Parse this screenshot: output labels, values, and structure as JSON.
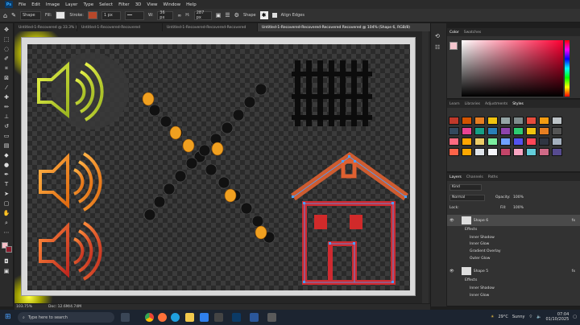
{
  "menu": {
    "items": [
      "File",
      "Edit",
      "Image",
      "Layer",
      "Type",
      "Select",
      "Filter",
      "3D",
      "View",
      "Window",
      "Help"
    ]
  },
  "options": {
    "mode": "Shape",
    "fill_label": "Fill:",
    "stroke_label": "Stroke:",
    "stroke_width": "1 px",
    "w_label": "W:",
    "w_value": "36 px",
    "h_label": "H:",
    "h_value": "287 px",
    "path_label": "Shape",
    "align_label": "Align Edges"
  },
  "tabs": [
    "Untitled-1-Recovered @ 33.3% (...",
    "Untitled-1-Recovered-Recovered",
    "Untitled-1-Recovered-Recovered-Recovered",
    "Untitled-1-Recovered-Recovered-Recovered Recovered @ 104% (Shape 6, RGB/8)"
  ],
  "status": {
    "zoom": "103.75%",
    "doc": "Doc: 12.6M/4.74M"
  },
  "panels": {
    "color_tabs": [
      "Color",
      "Swatches"
    ],
    "style_tabs": [
      "Learn",
      "Libraries",
      "Adjustments",
      "Styles"
    ],
    "layer_tabs": [
      "Layers",
      "Channels",
      "Paths"
    ],
    "kind": "Kind",
    "blend": "Normal",
    "opacity_label": "Opacity:",
    "opacity": "100%",
    "lock_label": "Lock:",
    "fill_label": "Fill:",
    "fill": "100%",
    "layers": [
      {
        "name": "Shape 6",
        "kind": "layer"
      },
      {
        "name": "Effects",
        "kind": "fxgroup"
      },
      {
        "name": "Inner Shadow",
        "kind": "effect"
      },
      {
        "name": "Inner Glow",
        "kind": "effect"
      },
      {
        "name": "Gradient Overlay",
        "kind": "effect"
      },
      {
        "name": "Outer Glow",
        "kind": "effect"
      },
      {
        "name": "Shape 5",
        "kind": "layer"
      },
      {
        "name": "Effects",
        "kind": "fxgroup"
      },
      {
        "name": "Inner Shadow",
        "kind": "effect"
      },
      {
        "name": "Inner Glow",
        "kind": "effect"
      }
    ],
    "fx_label": "fx"
  },
  "swatch_colors": [
    "#c0392b",
    "#d35400",
    "#e67e22",
    "#f1c40f",
    "#95a5a6",
    "#7f8c8d",
    "#e74c3c",
    "#f39c12",
    "#bdc3c7",
    "#34495e",
    "#e84393",
    "#16a085",
    "#2980b9",
    "#8e44ad",
    "#2ecc71",
    "#f1c40f",
    "#e67e22",
    "#555555",
    "#ff6b81",
    "#ffa502",
    "#eccc68",
    "#7bed9f",
    "#70a1ff",
    "#5352ed",
    "#ff4757",
    "#2f3542",
    "#a4b0be",
    "#ff6348",
    "#ffa801",
    "#dfe4ea",
    "#f5f6fa",
    "#c44569",
    "#f8a5c2",
    "#63cdda",
    "#cf6a87",
    "#574b90"
  ],
  "taskbar": {
    "search_placeholder": "Type here to search",
    "weather": "29°C",
    "weather_desc": "Sunny",
    "time": "07:04",
    "date": "01/10/2025"
  }
}
